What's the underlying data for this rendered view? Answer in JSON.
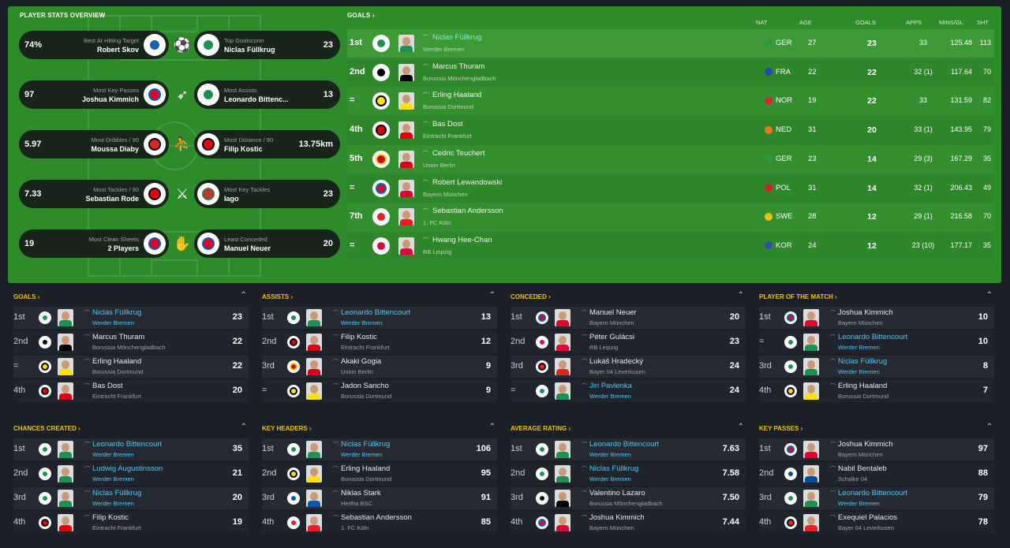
{
  "colors": {
    "pitch": "#2e8b2a",
    "panel_title": "#f2c200",
    "highlight": "#50c8f0",
    "background": "#1c1f26"
  },
  "stats_overview": {
    "title": "PLAYER STATS OVERVIEW",
    "cards": [
      {
        "left_value": "74%",
        "left_caption": "Best At Hitting Target",
        "left_name": "Robert Skov",
        "left_club": "hoffenheim",
        "icon": "shooting-icon",
        "right_caption": "Top Goalscorer",
        "right_name": "Niclas Füllkrug",
        "right_club": "bremen",
        "right_value": "23"
      },
      {
        "left_value": "97",
        "left_caption": "Most Key Passes",
        "left_name": "Joshua Kimmich",
        "left_club": "bayern",
        "icon": "passing-icon",
        "right_caption": "Most Assists",
        "right_name": "Leonardo Bittenc...",
        "right_club": "bremen",
        "right_value": "13"
      },
      {
        "left_value": "5.97",
        "left_caption": "Most Dribbles / 90",
        "left_name": "Moussa Diaby",
        "left_club": "leverkusen",
        "icon": "dribbling-icon",
        "right_caption": "Most Distance / 90",
        "right_name": "Filip Kostic",
        "right_club": "frankfurt",
        "right_value": "13.75km"
      },
      {
        "left_value": "7.33",
        "left_caption": "Most Tackles / 90",
        "left_name": "Sebastian Rode",
        "left_club": "frankfurt",
        "icon": "tackle-icon",
        "right_caption": "Most Key Tackles",
        "right_name": "Iago",
        "right_club": "augsburg",
        "right_value": "23"
      },
      {
        "left_value": "19",
        "left_caption": "Most Clean Sheets",
        "left_name": "2 Players",
        "left_club": "bayern",
        "icon": "goalkeeper-icon",
        "right_caption": "Least Conceded",
        "right_name": "Manuel Neuer",
        "right_club": "bayern",
        "right_value": "20"
      }
    ]
  },
  "goals_table": {
    "title": "GOALS",
    "headers": {
      "nat": "NAT",
      "age": "AGE",
      "goals": "GOALS",
      "apps": "APPS",
      "mins": "MINS/GL",
      "sht": "SHT"
    },
    "rows": [
      {
        "rank": "1st",
        "name": "Niclas Füllkrug",
        "club": "Werder Bremen",
        "crest": "bremen",
        "nat": "GER",
        "age": "27",
        "goals": "23",
        "apps": "33",
        "mins": "125.48",
        "sht": "113",
        "highlight": true
      },
      {
        "rank": "2nd",
        "name": "Marcus Thuram",
        "club": "Borussia Mönchengladbach",
        "crest": "gladbach",
        "nat": "FRA",
        "age": "22",
        "goals": "22",
        "apps": "32 (1)",
        "mins": "117.64",
        "sht": "70",
        "highlight": false
      },
      {
        "rank": "=",
        "name": "Erling Haaland",
        "club": "Borussia Dortmund",
        "crest": "dortmund",
        "nat": "NOR",
        "age": "19",
        "goals": "22",
        "apps": "33",
        "mins": "131.59",
        "sht": "82",
        "highlight": false
      },
      {
        "rank": "4th",
        "name": "Bas Dost",
        "club": "Eintracht Frankfurt",
        "crest": "frankfurt",
        "nat": "NED",
        "age": "31",
        "goals": "20",
        "apps": "33 (1)",
        "mins": "143.95",
        "sht": "79",
        "highlight": false
      },
      {
        "rank": "5th",
        "name": "Cedric Teuchert",
        "club": "Union Berlin",
        "crest": "union",
        "nat": "GER",
        "age": "23",
        "goals": "14",
        "apps": "29 (3)",
        "mins": "167.29",
        "sht": "35",
        "highlight": false
      },
      {
        "rank": "=",
        "name": "Robert Lewandowski",
        "club": "Bayern München",
        "crest": "bayern",
        "nat": "POL",
        "age": "31",
        "goals": "14",
        "apps": "32 (1)",
        "mins": "206.43",
        "sht": "49",
        "highlight": false
      },
      {
        "rank": "7th",
        "name": "Sebastian Andersson",
        "club": "1. FC Köln",
        "crest": "koln",
        "nat": "SWE",
        "age": "28",
        "goals": "12",
        "apps": "29 (1)",
        "mins": "216.58",
        "sht": "70",
        "highlight": false
      },
      {
        "rank": "=",
        "name": "Hwang Hee-Chan",
        "club": "RB Leipzig",
        "crest": "leipzig",
        "nat": "KOR",
        "age": "24",
        "goals": "12",
        "apps": "23 (10)",
        "mins": "177.17",
        "sht": "35",
        "highlight": false
      }
    ]
  },
  "panels": [
    {
      "title": "GOALS",
      "rows": [
        {
          "rank": "1st",
          "name": "Niclas Füllkrug",
          "club": "Werder Bremen",
          "crest": "bremen",
          "value": "23",
          "hl": true
        },
        {
          "rank": "2nd",
          "name": "Marcus Thuram",
          "club": "Borussia Mönchengladbach",
          "crest": "gladbach",
          "value": "22",
          "hl": false
        },
        {
          "rank": "=",
          "name": "Erling Haaland",
          "club": "Borussia Dortmund",
          "crest": "dortmund",
          "value": "22",
          "hl": false
        },
        {
          "rank": "4th",
          "name": "Bas Dost",
          "club": "Eintracht Frankfurt",
          "crest": "frankfurt",
          "value": "20",
          "hl": false
        }
      ]
    },
    {
      "title": "ASSISTS",
      "rows": [
        {
          "rank": "1st",
          "name": "Leonardo Bittencourt",
          "club": "Werder Bremen",
          "crest": "bremen",
          "value": "13",
          "hl": true
        },
        {
          "rank": "2nd",
          "name": "Filip Kostic",
          "club": "Eintracht Frankfurt",
          "crest": "frankfurt",
          "value": "12",
          "hl": false
        },
        {
          "rank": "3rd",
          "name": "Akaki Gogia",
          "club": "Union Berlin",
          "crest": "union",
          "value": "9",
          "hl": false
        },
        {
          "rank": "=",
          "name": "Jadon Sancho",
          "club": "Borussia Dortmund",
          "crest": "dortmund",
          "value": "9",
          "hl": false
        }
      ]
    },
    {
      "title": "CONCEDED",
      "rows": [
        {
          "rank": "1st",
          "name": "Manuel Neuer",
          "club": "Bayern München",
          "crest": "bayern",
          "value": "20",
          "hl": false
        },
        {
          "rank": "2nd",
          "name": "Péter Gulácsi",
          "club": "RB Leipzig",
          "crest": "leipzig",
          "value": "23",
          "hl": false
        },
        {
          "rank": "3rd",
          "name": "Lukáš Hradecký",
          "club": "Bayer 04 Leverkusen",
          "crest": "leverkusen",
          "value": "24",
          "hl": false
        },
        {
          "rank": "=",
          "name": "Jiri Pavlenka",
          "club": "Werder Bremen",
          "crest": "bremen",
          "value": "24",
          "hl": true
        }
      ]
    },
    {
      "title": "PLAYER OF THE MATCH",
      "rows": [
        {
          "rank": "1st",
          "name": "Joshua Kimmich",
          "club": "Bayern München",
          "crest": "bayern",
          "value": "10",
          "hl": false
        },
        {
          "rank": "=",
          "name": "Leonardo Bittencourt",
          "club": "Werder Bremen",
          "crest": "bremen",
          "value": "10",
          "hl": true
        },
        {
          "rank": "3rd",
          "name": "Niclas Füllkrug",
          "club": "Werder Bremen",
          "crest": "bremen",
          "value": "8",
          "hl": true
        },
        {
          "rank": "4th",
          "name": "Erling Haaland",
          "club": "Borussia Dortmund",
          "crest": "dortmund",
          "value": "7",
          "hl": false
        }
      ]
    },
    {
      "title": "CHANCES CREATED",
      "rows": [
        {
          "rank": "1st",
          "name": "Leonardo Bittencourt",
          "club": "Werder Bremen",
          "crest": "bremen",
          "value": "35",
          "hl": true
        },
        {
          "rank": "2nd",
          "name": "Ludwig Augustinsson",
          "club": "Werder Bremen",
          "crest": "bremen",
          "value": "21",
          "hl": true
        },
        {
          "rank": "3rd",
          "name": "Niclas Füllkrug",
          "club": "Werder Bremen",
          "crest": "bremen",
          "value": "20",
          "hl": true
        },
        {
          "rank": "4th",
          "name": "Filip Kostic",
          "club": "Eintracht Frankfurt",
          "crest": "frankfurt",
          "value": "19",
          "hl": false
        }
      ]
    },
    {
      "title": "KEY HEADERS",
      "rows": [
        {
          "rank": "1st",
          "name": "Niclas Füllkrug",
          "club": "Werder Bremen",
          "crest": "bremen",
          "value": "106",
          "hl": true
        },
        {
          "rank": "2nd",
          "name": "Erling Haaland",
          "club": "Borussia Dortmund",
          "crest": "dortmund",
          "value": "95",
          "hl": false
        },
        {
          "rank": "3rd",
          "name": "Niklas Stark",
          "club": "Hertha BSC",
          "crest": "hertha",
          "value": "91",
          "hl": false
        },
        {
          "rank": "4th",
          "name": "Sebastian Andersson",
          "club": "1. FC Köln",
          "crest": "koln",
          "value": "85",
          "hl": false
        }
      ]
    },
    {
      "title": "AVERAGE RATING",
      "rows": [
        {
          "rank": "1st",
          "name": "Leonardo Bittencourt",
          "club": "Werder Bremen",
          "crest": "bremen",
          "value": "7.63",
          "hl": true
        },
        {
          "rank": "2nd",
          "name": "Niclas Füllkrug",
          "club": "Werder Bremen",
          "crest": "bremen",
          "value": "7.58",
          "hl": true
        },
        {
          "rank": "3rd",
          "name": "Valentino Lazaro",
          "club": "Borussia Mönchengladbach",
          "crest": "gladbach",
          "value": "7.50",
          "hl": false
        },
        {
          "rank": "4th",
          "name": "Joshua Kimmich",
          "club": "Bayern München",
          "crest": "bayern",
          "value": "7.44",
          "hl": false
        }
      ]
    },
    {
      "title": "KEY PASSES",
      "rows": [
        {
          "rank": "1st",
          "name": "Joshua Kimmich",
          "club": "Bayern München",
          "crest": "bayern",
          "value": "97",
          "hl": false
        },
        {
          "rank": "2nd",
          "name": "Nabil Bentaleb",
          "club": "Schalke 04",
          "crest": "schalke",
          "value": "88",
          "hl": false
        },
        {
          "rank": "3rd",
          "name": "Leonardo Bittencourt",
          "club": "Werder Bremen",
          "crest": "bremen",
          "value": "79",
          "hl": true
        },
        {
          "rank": "4th",
          "name": "Exequiel Palacios",
          "club": "Bayer 04 Leverkusen",
          "crest": "leverkusen",
          "value": "78",
          "hl": false
        }
      ]
    }
  ]
}
